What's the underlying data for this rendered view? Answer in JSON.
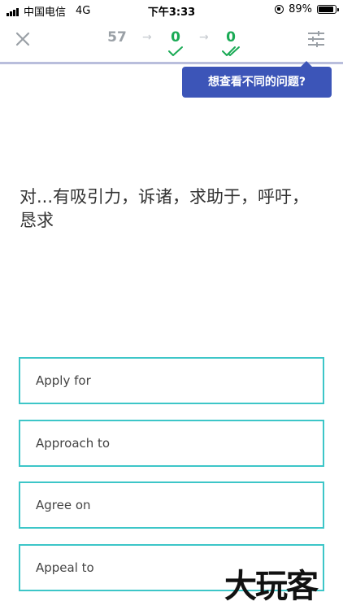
{
  "status_bar": {
    "carrier": "中国电信",
    "network": "4G",
    "time": "下午3:33",
    "battery_percent": "89%",
    "battery_level": 0.89
  },
  "nav": {
    "total_count": "57",
    "correct_count": "0",
    "mastered_count": "0",
    "icons": {
      "close": "close-icon",
      "arrow": "arrow-right-icon",
      "check": "check-icon",
      "double_check": "double-check-icon",
      "settings": "sliders-icon"
    }
  },
  "tooltip": {
    "text": "想查看不同的问题?"
  },
  "question": {
    "text": "对...有吸引力，诉诸，求助于，呼吁，恳求"
  },
  "options": [
    {
      "label": "Apply for"
    },
    {
      "label": "Approach to"
    },
    {
      "label": "Agree on"
    },
    {
      "label": "Appeal to"
    }
  ],
  "watermark": {
    "text": "大玩客"
  },
  "colors": {
    "green": "#1aaa55",
    "option_border": "#3dc6c8",
    "tooltip_bg": "#3c55b8",
    "divider": "#b9bedc",
    "gray": "#9aa0a6"
  }
}
